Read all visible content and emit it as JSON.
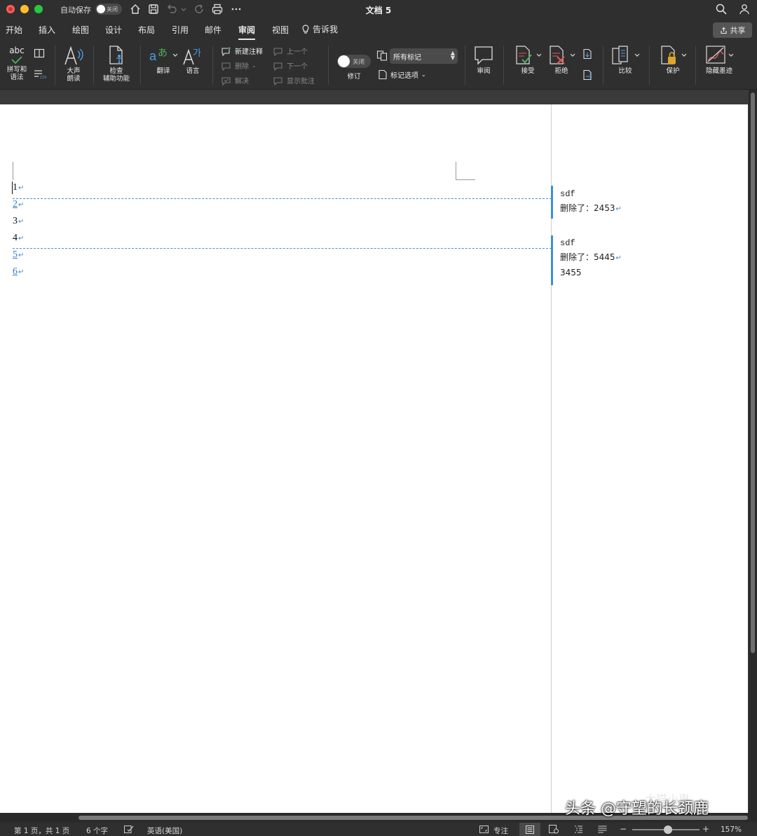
{
  "window": {
    "title": "文档 5",
    "autosave_label": "自动保存",
    "autosave_state": "关闭"
  },
  "menu": {
    "tabs": [
      "开始",
      "插入",
      "绘图",
      "设计",
      "布局",
      "引用",
      "邮件",
      "审阅",
      "视图"
    ],
    "active_tab": "审阅",
    "tell_me": "告诉我",
    "share": "共享"
  },
  "ribbon": {
    "spelling": "拼写和\n语法",
    "spelling_icon_text": "abc",
    "read_aloud": "大声\n朗读",
    "accessibility": "检查\n辅助功能",
    "translate": "翻译",
    "language": "语言",
    "new_comment": "新建注释",
    "delete": "删除",
    "resolve": "解决",
    "previous": "上一个",
    "next": "下一个",
    "show_comments": "显示批注",
    "track_changes_state": "关闭",
    "track_changes": "修订",
    "markup_display": "所有标记",
    "markup_options": "标记选项",
    "reviewing": "审阅",
    "accept": "接受",
    "reject": "拒绝",
    "compare": "比较",
    "protect": "保护",
    "hide_ink": "隐藏墨迹"
  },
  "document": {
    "lines": [
      {
        "text": "1",
        "inserted": false
      },
      {
        "text": "2",
        "inserted": true
      },
      {
        "text": "3",
        "inserted": false
      },
      {
        "text": "4",
        "inserted": false
      },
      {
        "text": "5",
        "inserted": true
      },
      {
        "text": "6",
        "inserted": true
      }
    ],
    "paragraph_mark": "↵",
    "comments": [
      {
        "author": "sdf",
        "text": "删除了：2453"
      },
      {
        "author": "sdf",
        "text": "删除了：5445",
        "extra": "3455"
      }
    ]
  },
  "status": {
    "page": "第 1 页，共 1 页",
    "words": "6 个字",
    "language": "英语(美国)",
    "focus": "专注",
    "zoom": "157%",
    "zoom_minus": "−",
    "zoom_plus": "+"
  },
  "watermark": "头条 @守望的长颈鹿",
  "watermark_faint": "大猫小鬼"
}
